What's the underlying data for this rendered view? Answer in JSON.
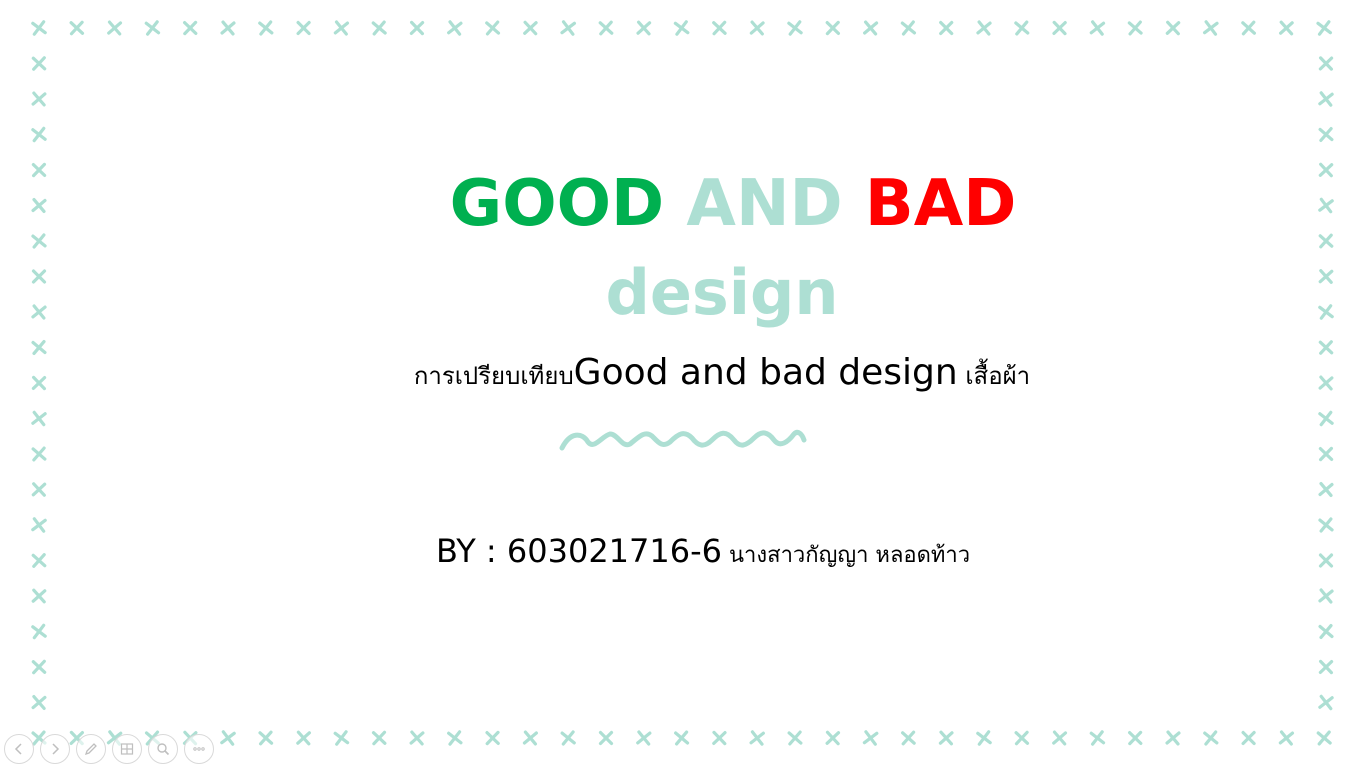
{
  "slide": {
    "title_line1": [
      {
        "text": "GOOD",
        "color": "#00b050"
      },
      {
        "text": " AND ",
        "color": "#addfd3"
      },
      {
        "text": "BAD",
        "color": "#ff0000"
      }
    ],
    "title_line2": {
      "text": "design",
      "color": "#addfd3"
    },
    "subtitle": {
      "thai_prefix": "การเปรียบเทียบ",
      "latin": "Good and bad design",
      "thai_suffix": " เสื้อผ้า"
    },
    "byline": {
      "id_text": "BY : 603021716-6",
      "name_text": " นางสาวกัญญา หลอดท้าว"
    },
    "accent_color": "#addfd3"
  },
  "controls": [
    {
      "name": "previous-slide-button",
      "icon": "arrow-left-icon"
    },
    {
      "name": "next-slide-button",
      "icon": "arrow-right-icon"
    },
    {
      "name": "pen-tool-button",
      "icon": "pen-icon"
    },
    {
      "name": "see-all-slides-button",
      "icon": "grid-icon"
    },
    {
      "name": "zoom-button",
      "icon": "magnifier-icon"
    },
    {
      "name": "more-options-button",
      "icon": "more-icon"
    }
  ]
}
